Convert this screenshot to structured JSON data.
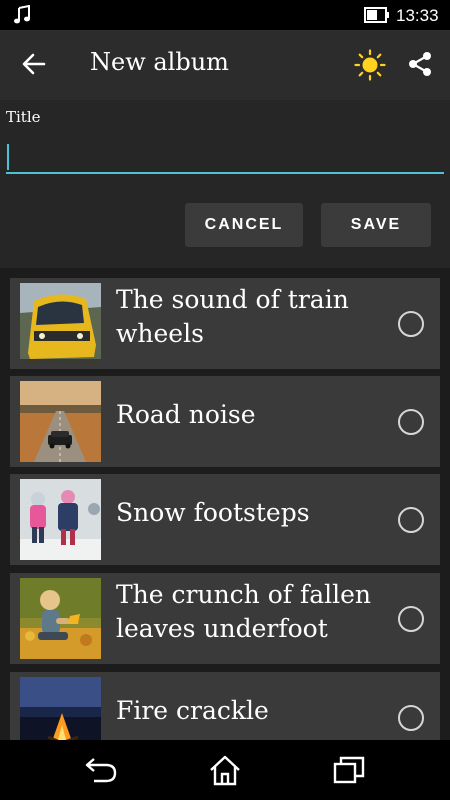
{
  "status_bar": {
    "time": "13:33",
    "icons": [
      "music-note-icon",
      "battery-icon"
    ]
  },
  "app_bar": {
    "title": "New album",
    "icons": [
      "back-arrow-icon",
      "sun-icon",
      "share-icon"
    ]
  },
  "form": {
    "title_label": "Title",
    "title_value": "",
    "cancel_label": "CANCEL",
    "save_label": "SAVE"
  },
  "sounds": [
    {
      "label": "The sound of train wheels",
      "selected": false
    },
    {
      "label": "Road noise",
      "selected": false
    },
    {
      "label": "Snow footsteps",
      "selected": false
    },
    {
      "label": "The crunch of fallen leaves underfoot",
      "selected": false
    },
    {
      "label": "Fire crackle",
      "selected": false
    }
  ],
  "nav_bar": {
    "icons": [
      "back-icon",
      "home-icon",
      "recents-icon"
    ]
  },
  "colors": {
    "accent": "#4fc3d6",
    "sun": "#ffd21f",
    "toolbar": "#2c2c2c",
    "card": "#3a3a3a"
  }
}
